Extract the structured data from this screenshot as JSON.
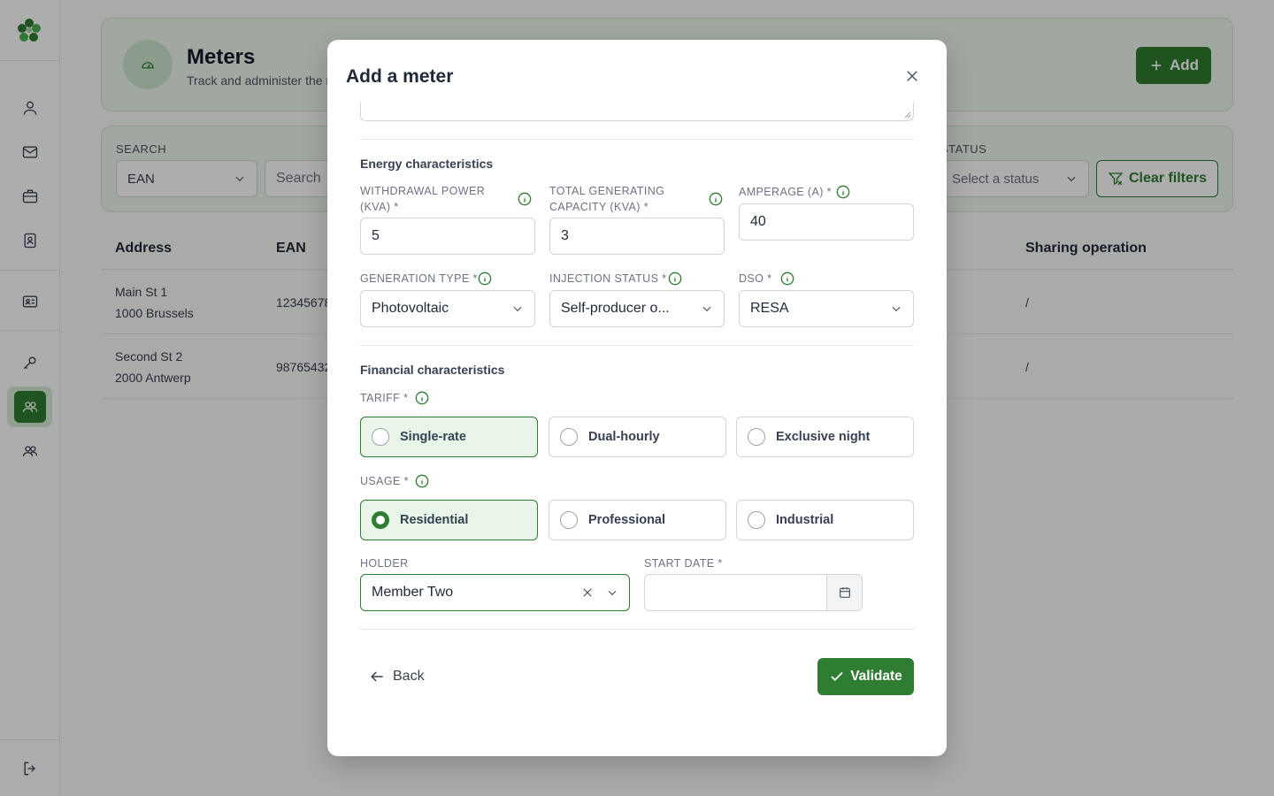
{
  "app": {
    "sidebar": {
      "items": [
        "user-icon",
        "mail-icon",
        "briefcase-icon",
        "contact-book-icon",
        "id-card-icon",
        "key-icon",
        "users-icon",
        "team-icon"
      ],
      "logout_icon": "logout-icon"
    },
    "header": {
      "title": "Meters",
      "subtitle": "Track and administer the m",
      "add_label": "Add"
    },
    "filters": {
      "search_label": "SEARCH",
      "search_type": "EAN",
      "search_placeholder": "Search",
      "status_label": "STATUS",
      "status_placeholder": "Select a status",
      "clear_label": "Clear filters"
    },
    "table": {
      "columns": [
        "Address",
        "EAN",
        "Sharing operation"
      ],
      "rows": [
        {
          "address_line1": "Main St 1",
          "address_line2": "1000 Brussels",
          "ean": "12345678",
          "sharing": "/"
        },
        {
          "address_line1": "Second St 2",
          "address_line2": "2000 Antwerp",
          "ean": "98765432",
          "sharing": "/"
        }
      ]
    }
  },
  "modal": {
    "title": "Add a meter",
    "energy": {
      "section_title": "Energy characteristics",
      "withdrawal_label_1": "WITHDRAWAL POWER",
      "withdrawal_label_2": "(KVA) *",
      "withdrawal_value": "5",
      "capacity_label_1": "TOTAL GENERATING",
      "capacity_label_2": "CAPACITY (KVA) *",
      "capacity_value": "3",
      "amperage_label": "AMPERAGE (A) *",
      "amperage_value": "40",
      "generation_label": "GENERATION TYPE *",
      "generation_value": "Photovoltaic",
      "injection_label": "INJECTION STATUS *",
      "injection_value": "Self-producer o...",
      "dso_label": "DSO *",
      "dso_value": "RESA"
    },
    "financial": {
      "section_title": "Financial characteristics",
      "tariff_label": "TARIFF *",
      "tariff_options": [
        "Single-rate",
        "Dual-hourly",
        "Exclusive night"
      ],
      "tariff_selected": "Single-rate",
      "usage_label": "USAGE *",
      "usage_options": [
        "Residential",
        "Professional",
        "Industrial"
      ],
      "usage_selected": "Residential",
      "holder_label": "HOLDER",
      "holder_value": "Member Two",
      "start_date_label": "START DATE *",
      "start_date_value": ""
    },
    "back_label": "Back",
    "validate_label": "Validate"
  },
  "colors": {
    "accent": "#2e7d32",
    "accent_light": "#e8f5e8"
  }
}
